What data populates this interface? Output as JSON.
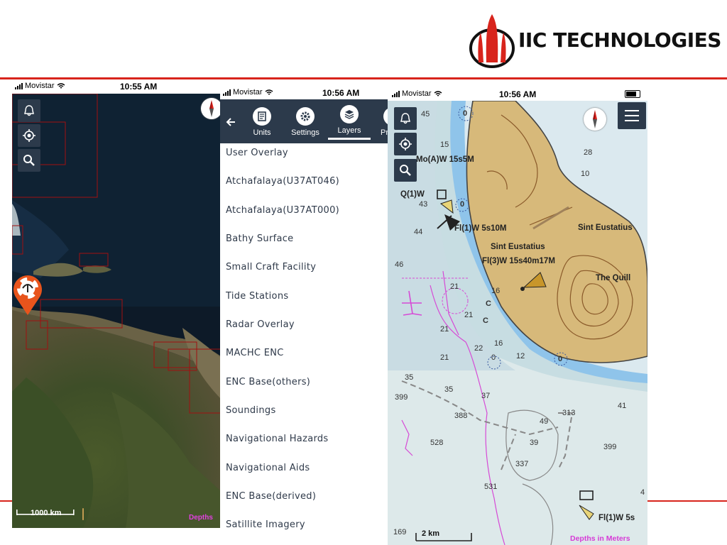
{
  "brand": {
    "name": "IIC TECHNOLOGIES",
    "red": "#d8241c"
  },
  "phone1": {
    "carrier": "Movistar",
    "time": "10:55 AM",
    "icons": [
      "bell-icon",
      "location-icon",
      "search-icon",
      "compass-icon",
      "lifebuoy-marker-icon"
    ],
    "scale": "1000 km",
    "depths": "Depths"
  },
  "phone2": {
    "carrier": "Movistar",
    "time": "10:56 AM",
    "toolbar": [
      {
        "label": "Units",
        "icon": "units-icon"
      },
      {
        "label": "Settings",
        "icon": "gear-icon"
      },
      {
        "label": "Layers",
        "icon": "layers-icon",
        "active": true
      },
      {
        "label": "Pr",
        "icon": "profile-icon"
      }
    ],
    "layers": [
      "User Overlay",
      "Atchafalaya(U37AT046)",
      "Atchafalaya(U37AT000)",
      "Bathy Surface",
      "Small Craft Facility",
      "Tide Stations",
      "Radar Overlay",
      "MACHC ENC",
      "ENC Base(others)",
      "Soundings",
      "Navigational Hazards",
      "Navigational Aids",
      "ENC Base(derived)",
      "Satillite Imagery"
    ]
  },
  "phone3": {
    "carrier": "Movistar",
    "time": "10:56 AM",
    "scale": "2 km",
    "depths": "Depths in Meters",
    "places": [
      "Sint Eustatius",
      "Sint Eustatius",
      "The Quill"
    ],
    "lights": [
      "Mo(A)W 15s5M",
      "Q(1)W",
      "Fl(1)W 5s10M",
      "Fl(3)W 15s40m17M",
      "Fl(1)W 5s"
    ],
    "soundings": [
      "45",
      "0",
      "15",
      "28",
      "10",
      "43",
      "0",
      "44",
      "46",
      "21",
      "16",
      "21",
      "21",
      "C",
      "C",
      "16",
      "12",
      "0",
      "0",
      "22",
      "21",
      "35",
      "35",
      "399",
      "37",
      "388",
      "313",
      "41",
      "49",
      "528",
      "39",
      "399",
      "337",
      "531",
      "169",
      "4"
    ]
  }
}
